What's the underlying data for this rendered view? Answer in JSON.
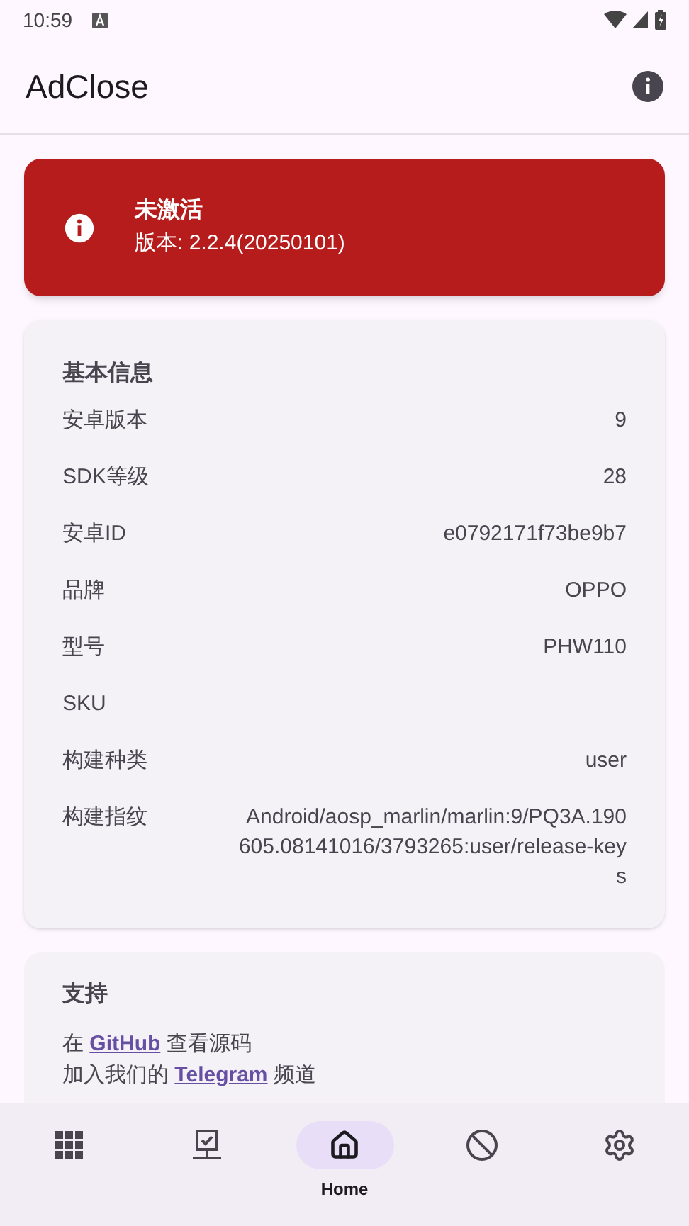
{
  "status_bar": {
    "time": "10:59"
  },
  "app_bar": {
    "title": "AdClose"
  },
  "status_card": {
    "title": "未激活",
    "version": "版本: 2.2.4(20250101)",
    "activated": false
  },
  "info_card": {
    "title": "基本信息",
    "rows": [
      {
        "label": "安卓版本",
        "value": "9"
      },
      {
        "label": "SDK等级",
        "value": "28"
      },
      {
        "label": "安卓ID",
        "value": "e0792171f73be9b7"
      },
      {
        "label": "品牌",
        "value": "OPPO"
      },
      {
        "label": "型号",
        "value": "PHW110"
      },
      {
        "label": "SKU",
        "value": ""
      },
      {
        "label": "构建种类",
        "value": "user"
      },
      {
        "label": "构建指纹",
        "value": "Android/aosp_marlin/marlin:9/PQ3A.190605.08141016/3793265:user/release-keys"
      }
    ]
  },
  "support_card": {
    "title": "支持",
    "lines": [
      {
        "before": "在",
        "link": "GitHub",
        "after": "查看源码"
      },
      {
        "before": "加入我们的",
        "link": "Telegram",
        "after": "频道"
      }
    ]
  },
  "bottom_nav": [
    {
      "kind": "apps",
      "selected": false
    },
    {
      "kind": "monitor",
      "selected": false
    },
    {
      "kind": "home",
      "label": "Home",
      "selected": true
    },
    {
      "kind": "block",
      "selected": false
    },
    {
      "kind": "settings",
      "selected": false
    }
  ]
}
